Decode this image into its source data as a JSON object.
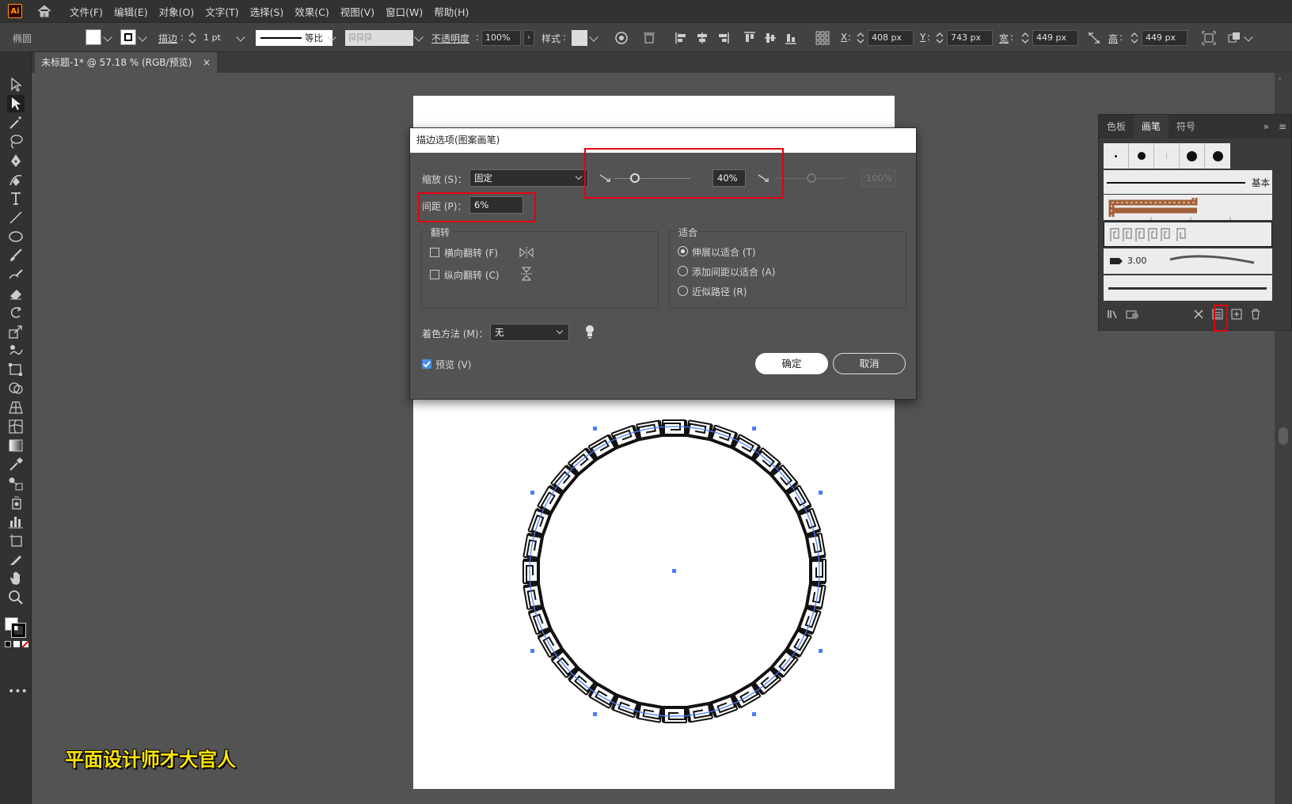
{
  "app": {
    "logo": "Ai"
  },
  "menubar": {
    "items": [
      "文件(F)",
      "编辑(E)",
      "对象(O)",
      "文字(T)",
      "选择(S)",
      "效果(C)",
      "视图(V)",
      "窗口(W)",
      "帮助(H)"
    ]
  },
  "control_bar": {
    "object_type": "椭圆",
    "stroke_label": "描边",
    "stroke_value": "1 pt",
    "stroke_profile": "等比",
    "opacity_label": "不透明度",
    "opacity_value": "100%",
    "style_label": "样式",
    "x_label": "X",
    "x_value": "408 px",
    "y_label": "Y",
    "y_value": "743 px",
    "width_label": "宽",
    "width_value": "449 px",
    "height_label": "高",
    "height_value": "449 px"
  },
  "document": {
    "tab_title": "未标题-1* @ 57.18 % (RGB/预览)",
    "close": "×"
  },
  "brush_panel": {
    "tabs": [
      "色板",
      "画笔",
      "符号"
    ],
    "active_tab": "画笔",
    "basic_label": "基本",
    "calligraphic_size": "3.00"
  },
  "dialog": {
    "title": "描边选项(图案画笔)",
    "scale_label": "缩放 (S)：",
    "scale_value": "固定",
    "scale_percent": "40%",
    "scale_max": "100%",
    "spacing_label": "间距 (P)：",
    "spacing_value": "6%",
    "flip_group": "翻转",
    "flip_h": "横向翻转 (F)",
    "flip_v": "纵向翻转 (C)",
    "fit_group": "适合",
    "fit_stretch": "伸展以适合 (T)",
    "fit_spacing": "添加间距以适合 (A)",
    "fit_approx": "近似路径 (R)",
    "colorize_label": "着色方法 (M)：",
    "colorize_value": "无",
    "preview_label": "预览 (V)",
    "ok": "确定",
    "cancel": "取消"
  },
  "watermark": "平面设计师才大官人",
  "colors": {
    "accent_red": "#e60012",
    "selection_blue": "#4a7cff",
    "watermark_yellow": "#ffe600"
  }
}
